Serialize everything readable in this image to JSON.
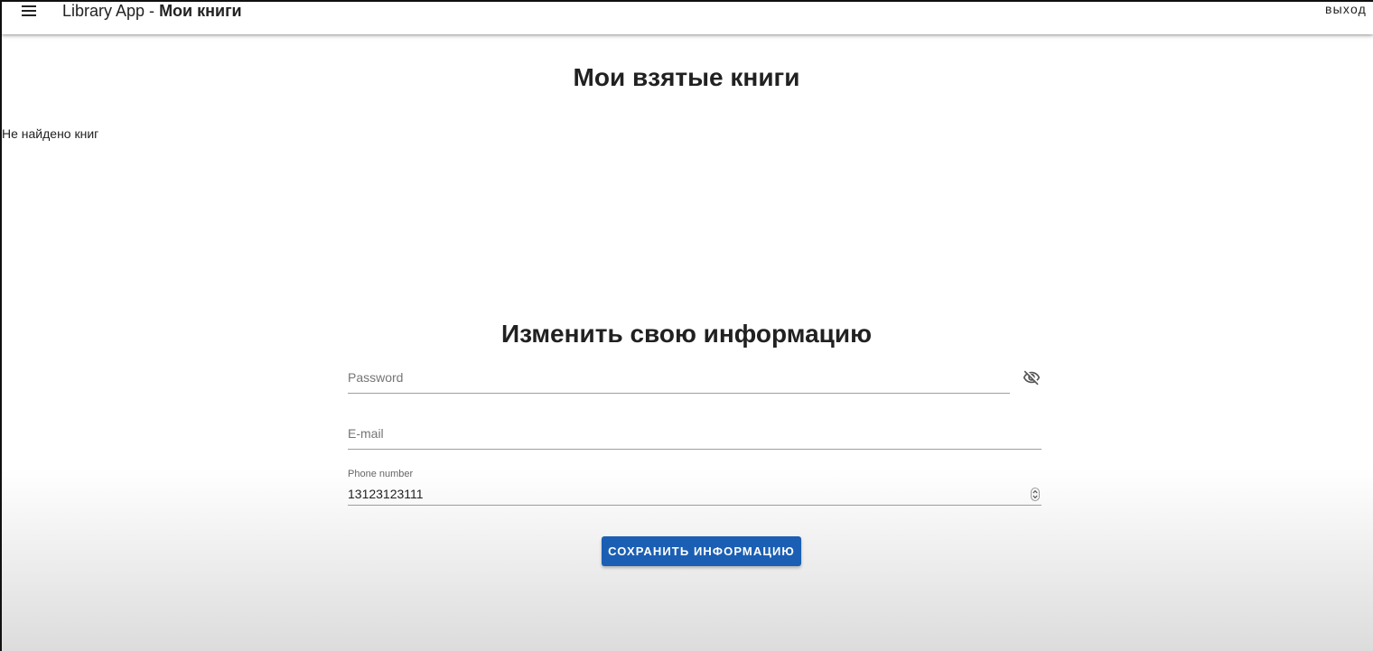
{
  "appbar": {
    "menu_icon": "hamburger-menu-icon",
    "title_prefix": "Library App - ",
    "title_page": "Мои книги",
    "logout_label": "выход"
  },
  "borrowed": {
    "heading": "Мои взятые книги",
    "empty_text": "Не найдено книг"
  },
  "profile_form": {
    "heading": "Изменить свою информацию",
    "password": {
      "placeholder": "Password",
      "value": "",
      "visibility_icon": "eye-off-icon"
    },
    "email": {
      "placeholder": "E-mail",
      "value": ""
    },
    "phone": {
      "label": "Phone number",
      "value": "13123123111",
      "stepper_icon": "number-stepper-icon"
    },
    "save_label": "СОХРАНИТЬ ИНФОРМАЦИЮ"
  },
  "colors": {
    "primary_button": "#1a5fb4",
    "appbar_bg": "#ffffff",
    "text": "#212121"
  }
}
